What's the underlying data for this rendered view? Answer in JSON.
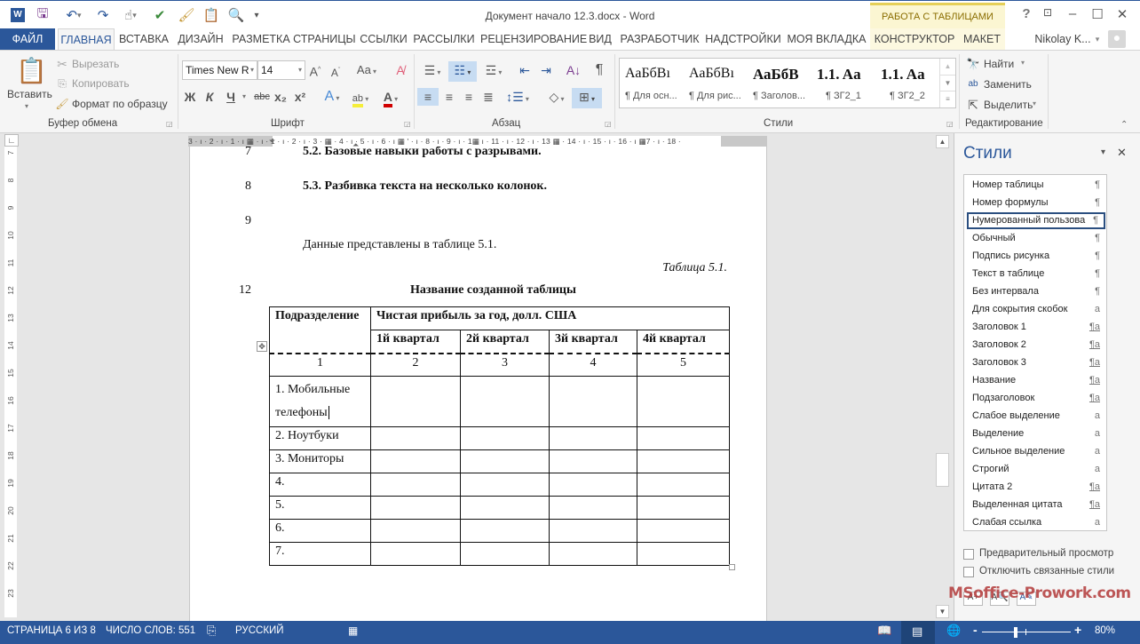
{
  "window": {
    "title": "Документ начало 12.3.docx - Word",
    "context_tab_group": "РАБОТА С ТАБЛИЦАМИ",
    "user": "Nikolay K..."
  },
  "quick_access": [
    "word-logo",
    "save-icon",
    "undo-icon",
    "redo-icon",
    "touch-mode-icon",
    "spellcheck-icon",
    "format-painter-icon",
    "paste-icon",
    "print-preview-icon",
    "customize-icon"
  ],
  "tabs": [
    {
      "label": "ФАЙЛ"
    },
    {
      "label": "ГЛАВНАЯ"
    },
    {
      "label": "ВСТАВКА"
    },
    {
      "label": "ДИЗАЙН"
    },
    {
      "label": "РАЗМЕТКА СТРАНИЦЫ"
    },
    {
      "label": "ССЫЛКИ"
    },
    {
      "label": "РАССЫЛКИ"
    },
    {
      "label": "РЕЦЕНЗИРОВАНИЕ"
    },
    {
      "label": "ВИД"
    },
    {
      "label": "РАЗРАБОТЧИК"
    },
    {
      "label": "НАДСТРОЙКИ"
    },
    {
      "label": "МОЯ ВКЛАДКА"
    },
    {
      "label": "КОНСТРУКТОР"
    },
    {
      "label": "МАКЕТ"
    }
  ],
  "ribbon": {
    "clipboard": {
      "paste": "Вставить",
      "cut": "Вырезать",
      "copy": "Копировать",
      "format_painter": "Формат по образцу",
      "label": "Буфер обмена"
    },
    "font": {
      "name": "Times New R",
      "size": "14",
      "label": "Шрифт",
      "bold": "Ж",
      "italic": "К",
      "underline": "Ч",
      "strike": "abc",
      "sub": "x₂",
      "sup": "x²",
      "case": "Aa"
    },
    "paragraph": {
      "label": "Абзац"
    },
    "styles": {
      "label": "Стили",
      "gallery": [
        {
          "preview": "АаБбВı",
          "name": "¶ Для осн..."
        },
        {
          "preview": "АаБбВı",
          "name": "¶ Для рис..."
        },
        {
          "preview": "АаБбВ",
          "name": "¶ Заголов..."
        },
        {
          "preview": "1.1.  Aa",
          "name": "¶ ЗГ2_1"
        },
        {
          "preview": "1.1.  Aa",
          "name": "¶ ЗГ2_2"
        }
      ]
    },
    "editing": {
      "find": "Найти",
      "replace": "Заменить",
      "select": "Выделить",
      "label": "Редактирование"
    }
  },
  "ruler": {
    "horizontal": "3 · ı · 2 · ı · 1 · ı ▦ · ı · 1 · ı · 2 · ı · 3 · ▦ · 4 · ı · 5 · ı · 6 · ı ▦ ' · ı · 8 · ı · 9 · ı · 1▦ ı · 11 · ı · 12 · ı · 13 ▦ · 14 · ı · 15 · ı · 16 · ı ▦7 · ı · 18 ·",
    "vertical": [
      "7",
      "8",
      "9",
      "10",
      "11",
      "12",
      "13",
      "14",
      "15",
      "16",
      "17",
      "18",
      "19",
      "20",
      "21",
      "22",
      "23"
    ]
  },
  "document": {
    "lines": [
      {
        "num": "7",
        "text": "5.2. Базовые навыки работы с разрывами."
      },
      {
        "num": "8",
        "text": "5.3. Разбивка текста на несколько колонок."
      },
      {
        "num": "9",
        "text": ""
      }
    ],
    "intro": "Данные представлены в таблице 5.1.",
    "caption_right": "Таблица 5.1.",
    "table_title_num": "12",
    "table_title": "Название созданной таблицы",
    "table": {
      "header_col1": "Подразделение",
      "header_group": "Чистая прибыль за год, долл. США",
      "quarters": [
        "1й квартал",
        "2й квартал",
        "3й квартал",
        "4й квартал"
      ],
      "col_numbers": [
        "1",
        "2",
        "3",
        "4",
        "5"
      ],
      "rows": [
        [
          "1. Мобильные телефоны",
          "",
          "",
          "",
          ""
        ],
        [
          "2. Ноутбуки",
          "",
          "",
          "",
          ""
        ],
        [
          "3. Мониторы",
          "",
          "",
          "",
          ""
        ],
        [
          "4.",
          "",
          "",
          "",
          ""
        ],
        [
          "5.",
          "",
          "",
          "",
          ""
        ],
        [
          "6.",
          "",
          "",
          "",
          ""
        ],
        [
          "7.",
          "",
          "",
          "",
          ""
        ]
      ]
    }
  },
  "styles_pane": {
    "title": "Стили",
    "items": [
      {
        "name": "Номер таблицы",
        "glyph": "¶"
      },
      {
        "name": "Номер формулы",
        "glyph": "¶"
      },
      {
        "name": "Нумерованный пользова",
        "glyph": "¶",
        "selected": true
      },
      {
        "name": "Обычный",
        "glyph": "¶"
      },
      {
        "name": "Подпись рисунка",
        "glyph": "¶"
      },
      {
        "name": "Текст в таблице",
        "glyph": "¶"
      },
      {
        "name": "Без интервала",
        "glyph": "¶"
      },
      {
        "name": "Для сокрытия скобок",
        "glyph": "a"
      },
      {
        "name": "Заголовок 1",
        "glyph": "¶a"
      },
      {
        "name": "Заголовок 2",
        "glyph": "¶a"
      },
      {
        "name": "Заголовок 3",
        "glyph": "¶a"
      },
      {
        "name": "Название",
        "glyph": "¶a"
      },
      {
        "name": "Подзаголовок",
        "glyph": "¶a"
      },
      {
        "name": "Слабое выделение",
        "glyph": "a"
      },
      {
        "name": "Выделение",
        "glyph": "a"
      },
      {
        "name": "Сильное выделение",
        "glyph": "a"
      },
      {
        "name": "Строгий",
        "glyph": "a"
      },
      {
        "name": "Цитата 2",
        "glyph": "¶a"
      },
      {
        "name": "Выделенная цитата",
        "glyph": "¶a"
      },
      {
        "name": "Слабая ссылка",
        "glyph": "a"
      }
    ],
    "preview_label": "Предварительный просмотр",
    "disable_linked_label": "Отключить связанные стили"
  },
  "status": {
    "page": "СТРАНИЦА 6 ИЗ 8",
    "words": "ЧИСЛО СЛОВ: 551",
    "language": "РУССКИЙ",
    "zoom": "80%",
    "zoom_percent": 80
  },
  "watermark": "MSoffice-Prowork.com",
  "colors": {
    "brand": "#2b579a",
    "context_tab": "#fbf6d2",
    "context_accent": "#e5cf57"
  }
}
